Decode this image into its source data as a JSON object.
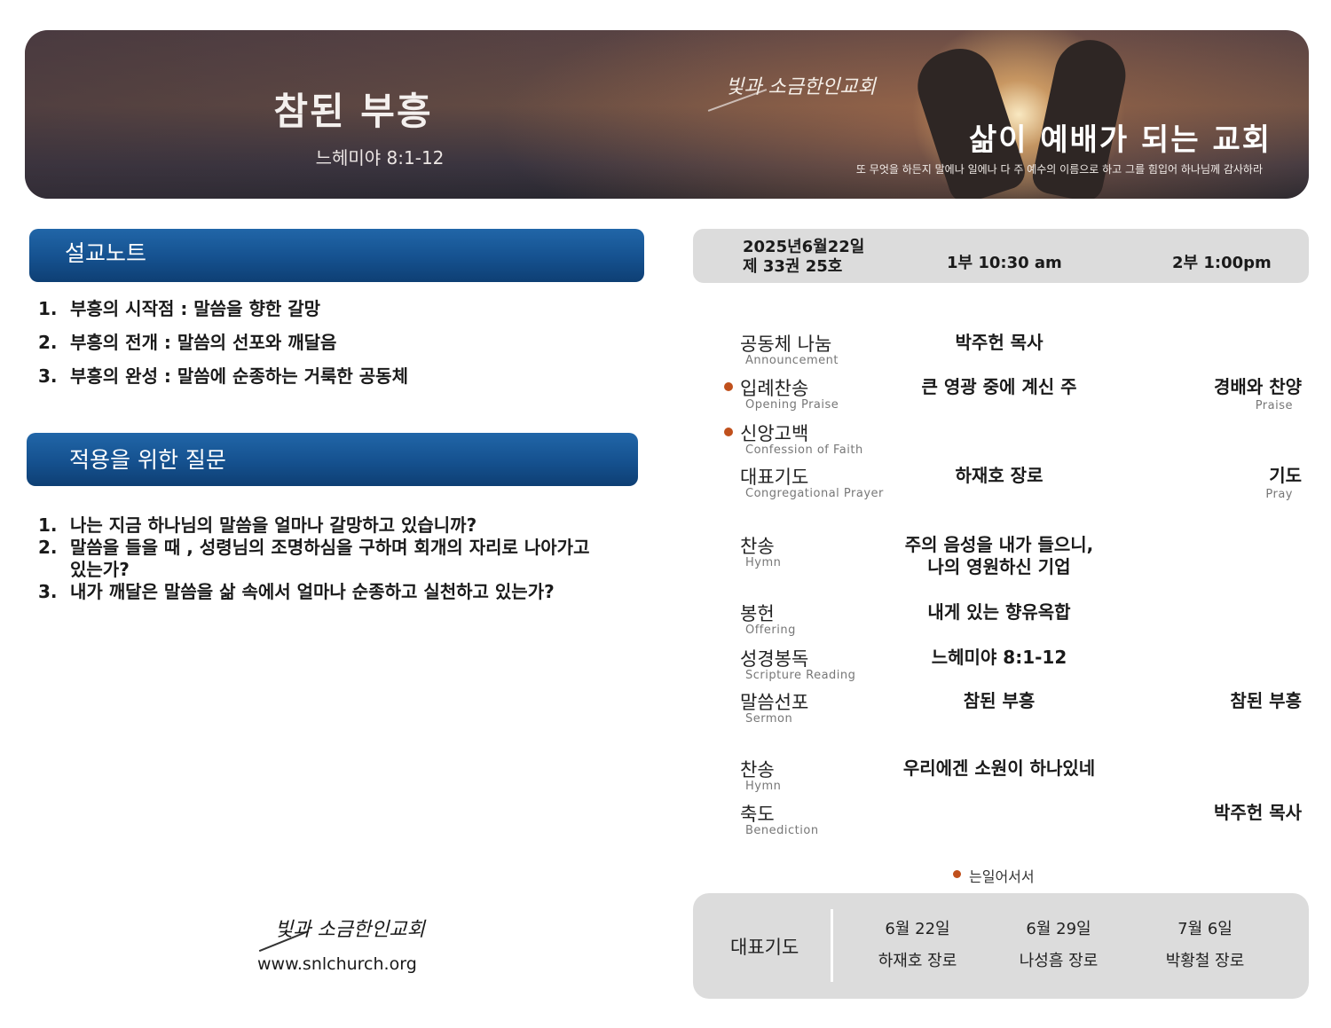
{
  "banner": {
    "title": "참된 부흥",
    "scripture": "느헤미야 8:1-12",
    "church_logo": "빛과 소금한인교회",
    "slogan": "삶이 예배가 되는 교회",
    "verse": "또 무엇을 하든지 말에나 일에나 다 주 예수의 이름으로 하고 그를 힘입어 하나님께 감사하라"
  },
  "sermon_notes": {
    "header": "설교노트",
    "items": [
      {
        "num": "1.",
        "text": "부흥의 시작점 : 말씀을 향한 갈망"
      },
      {
        "num": "2.",
        "text": "부흥의 전개 : 말씀의 선포와 깨달음"
      },
      {
        "num": "3.",
        "text": "부흥의 완성 : 말씀에 순종하는 거룩한 공동체"
      }
    ]
  },
  "questions": {
    "header": "적용을 위한 질문",
    "items": [
      {
        "num": "1.",
        "text": "나는 지금 하나님의 말씀을 얼마나 갈망하고 있습니까?"
      },
      {
        "num": "2.",
        "text": "말씀을 들을 때 , 성령님의 조명하심을 구하며 회개의 자리로 나아가고 있는가?"
      },
      {
        "num": "3.",
        "text": "내가 깨달은 말씀을 삶 속에서 얼마나 순종하고 실천하고 있는가?"
      }
    ]
  },
  "footer": {
    "logo": "빛과 소금한인교회",
    "url": "www.snlchurch.org"
  },
  "service_info": {
    "date": "2025년6월22일",
    "volume": "제 33권 25호",
    "service1": "1부 10:30 am",
    "service2": "2부 1:00pm"
  },
  "worship": [
    {
      "ko": "공동체 나눔",
      "en": "Announcement",
      "mid": "박주헌 목사",
      "right": "",
      "right_en": "",
      "stand": false
    },
    {
      "ko": "입례찬송",
      "en": "Opening Praise",
      "mid": "큰 영광 중에 계신 주",
      "right": "경배와 찬양",
      "right_en": "Praise",
      "stand": true
    },
    {
      "ko": "신앙고백",
      "en": "Confession of Faith",
      "mid": "",
      "right": "",
      "right_en": "",
      "stand": true
    },
    {
      "ko": "대표기도",
      "en": "Congregational Prayer",
      "mid": "하재호 장로",
      "right": "기도",
      "right_en": "Pray",
      "stand": false
    },
    {
      "ko": "찬송",
      "en": "Hymn",
      "mid": "주의 음성을 내가 들으니,\n나의 영원하신 기업",
      "right": "",
      "right_en": "",
      "stand": false
    },
    {
      "ko": "봉헌",
      "en": "Offering",
      "mid": "내게 있는 향유옥합",
      "right": "",
      "right_en": "",
      "stand": false
    },
    {
      "ko": "성경봉독",
      "en": "Scripture Reading",
      "mid": "느헤미야 8:1-12",
      "right": "",
      "right_en": "",
      "stand": false
    },
    {
      "ko": "말씀선포",
      "en": "Sermon",
      "mid": "참된 부흥",
      "right": "참된 부흥",
      "right_en": "",
      "stand": false
    },
    {
      "ko": "찬송",
      "en": "Hymn",
      "mid": "우리에겐 소원이 하나있네",
      "right": "",
      "right_en": "",
      "stand": false
    },
    {
      "ko": "축도",
      "en": "Benediction",
      "mid": "",
      "right": "박주헌 목사",
      "right_en": "",
      "stand": false
    }
  ],
  "stand_note": "는일어서서",
  "prayer_rota": {
    "label": "대표기도",
    "entries": [
      {
        "date": "6월 22일",
        "name": "하재호 장로"
      },
      {
        "date": "6월 29일",
        "name": "나성흠 장로"
      },
      {
        "date": "7월 6일",
        "name": "박황철 장로"
      }
    ]
  },
  "colors": {
    "header_blue": "#15518f",
    "accent_dot": "#c0501c",
    "panel_gray": "#dcdcdc"
  }
}
